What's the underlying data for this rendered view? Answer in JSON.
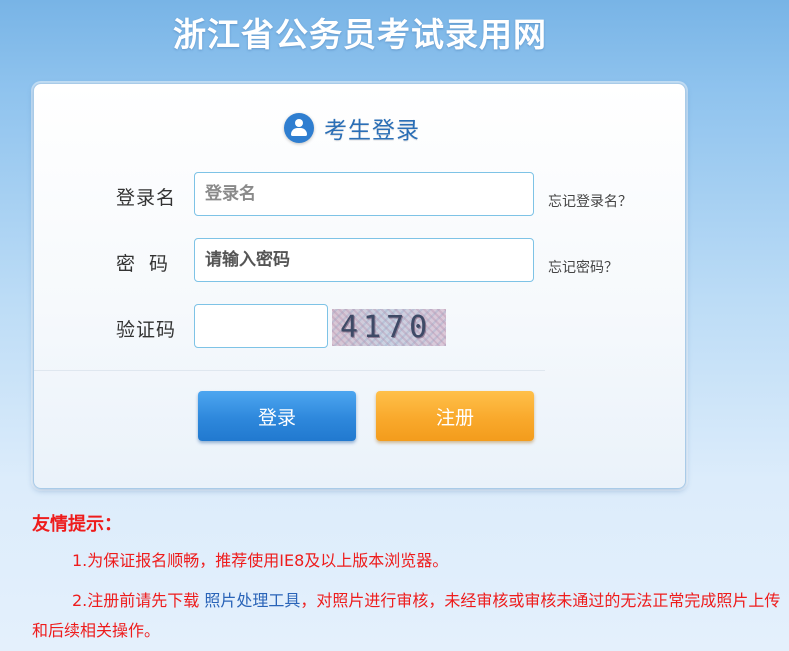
{
  "site_title": "浙江省公务员考试录用网",
  "login_panel": {
    "header": {
      "icon": "user-avatar-icon",
      "label": "考生登录"
    },
    "username": {
      "label": "登录名",
      "placeholder": "登录名",
      "forgot_link": "忘记登录名？"
    },
    "password": {
      "label": "密码",
      "placeholder": "请输入密码",
      "forgot_link": "忘记密码？"
    },
    "captcha": {
      "label": "验证码",
      "value": "",
      "image_text": "4170"
    },
    "buttons": {
      "login": "登录",
      "register": "注册"
    }
  },
  "tips": {
    "title": "友情提示：",
    "line1": "1.为保证报名顺畅，推荐使用IE8及以上版本浏览器。",
    "line2_before": "2.注册前请先下载",
    "line2_link": "照片处理工具",
    "line2_after": "，对照片进行审核，未经审核或审核未通过的无法正常完成照片上传和后续相关操作。"
  },
  "colors": {
    "primary_button": "#2e88dc",
    "register_button": "#f9a92c",
    "tip_text": "#ee1c1c",
    "link": "#2a64b8"
  }
}
